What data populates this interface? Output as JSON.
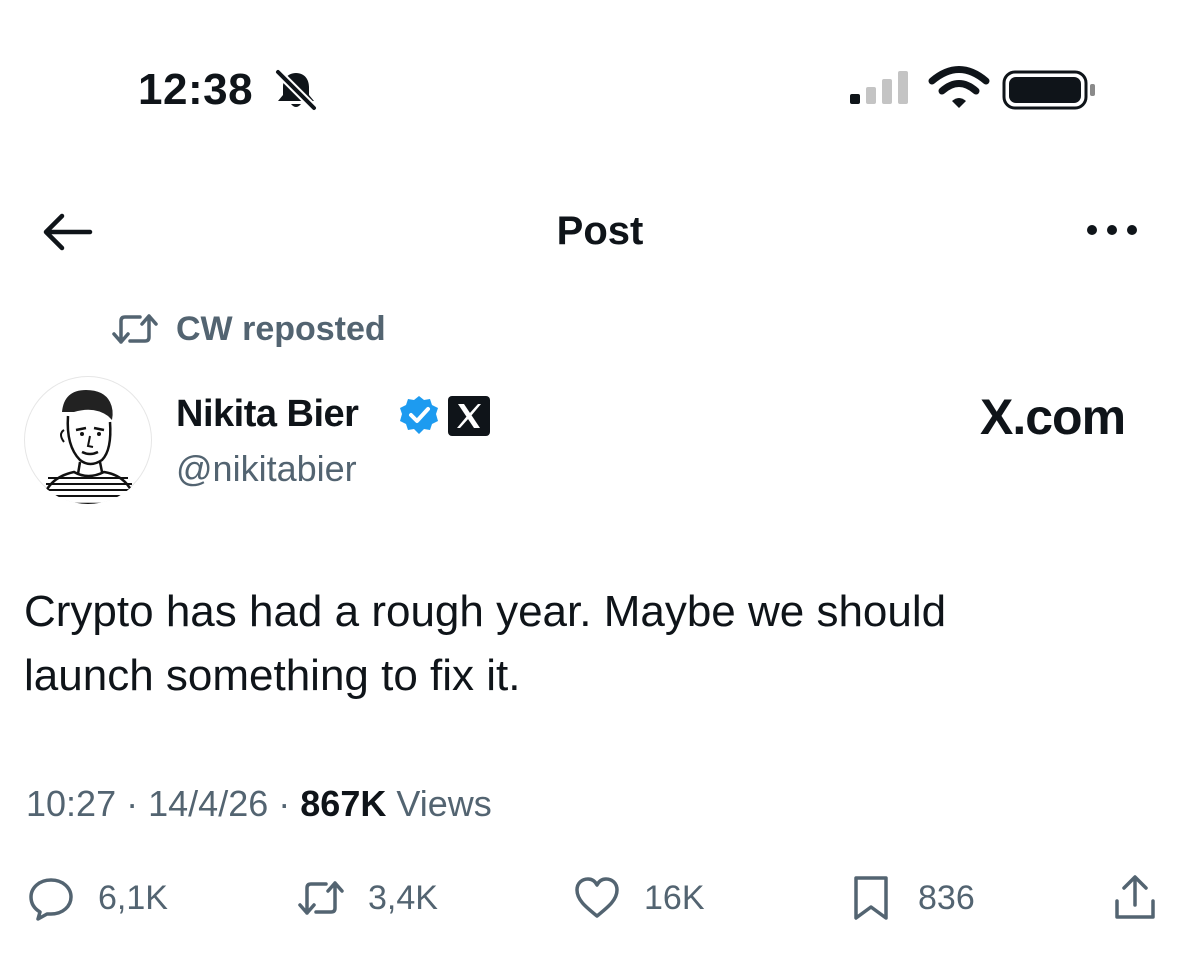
{
  "status_bar": {
    "time": "12:38",
    "icons": [
      "bell-slash-icon",
      "signal-icon",
      "wifi-icon",
      "battery-icon"
    ]
  },
  "header": {
    "title": "Post",
    "back_icon": "arrow-left-icon",
    "more_icon": "more-dots-icon"
  },
  "repost": {
    "label": "CW reposted",
    "icon": "repost-icon"
  },
  "author": {
    "name": "Nikita Bier",
    "handle": "@nikitabier",
    "badges": [
      "verified-icon",
      "x-logo-icon"
    ],
    "affiliation": "X.com"
  },
  "post": {
    "text_line1": "Crypto has had a rough year. Maybe we should",
    "text_line2": "launch something to fix it.",
    "time": "10:27",
    "date": "14/4/26",
    "views_count": "867K",
    "views_label": "Views",
    "separator": "·"
  },
  "actions": {
    "replies": "6,1K",
    "reposts": "3,4K",
    "likes": "16K",
    "bookmarks": "836"
  },
  "colors": {
    "text": "#0f1419",
    "secondary": "#536471",
    "verified": "#1d9bf0"
  }
}
